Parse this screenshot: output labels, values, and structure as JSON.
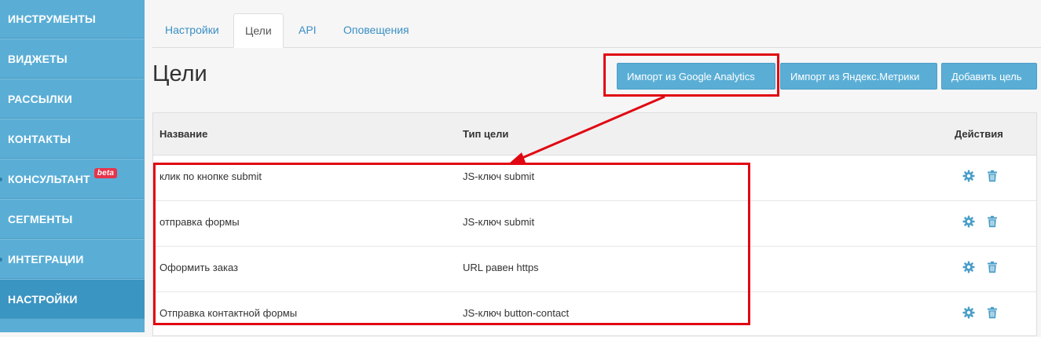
{
  "sidebar": {
    "items": [
      {
        "label": "ИНСТРУМЕНТЫ"
      },
      {
        "label": "ВИДЖЕТЫ"
      },
      {
        "label": "РАССЫЛКИ"
      },
      {
        "label": "КОНТАКТЫ"
      },
      {
        "label": "КОНСУЛЬТАНТ",
        "badge": "beta"
      },
      {
        "label": "СЕГМЕНТЫ"
      },
      {
        "label": "ИНТЕГРАЦИИ"
      },
      {
        "label": "НАСТРОЙКИ",
        "active": true
      }
    ]
  },
  "tabs": [
    "Настройки",
    "Цели",
    "API",
    "Оповещения"
  ],
  "active_tab": "Цели",
  "page_title": "Цели",
  "buttons": {
    "import_ga": "Импорт из Google Analytics",
    "import_ym": "Импорт из Яндекс.Метрики",
    "add_goal": "Добавить цель"
  },
  "table": {
    "headers": {
      "name": "Название",
      "type": "Тип цели",
      "actions": "Действия"
    },
    "rows": [
      {
        "name": "клик по кнопке submit",
        "type": "JS-ключ submit"
      },
      {
        "name": "отправка формы",
        "type": "JS-ключ submit"
      },
      {
        "name": "Оформить заказ",
        "type": "URL равен https"
      },
      {
        "name": "Отправка контактной формы",
        "type": "JS-ключ button-contact"
      }
    ]
  },
  "colors": {
    "sidebar": "#5aaed6",
    "sidebar_active": "#3b95c2",
    "button": "#5aaed6",
    "tab_link": "#3a8fc4",
    "annotation": "#e10712",
    "icon": "#4a9ec8"
  },
  "icons": {
    "edit": "gear-icon",
    "delete": "trash-icon"
  }
}
